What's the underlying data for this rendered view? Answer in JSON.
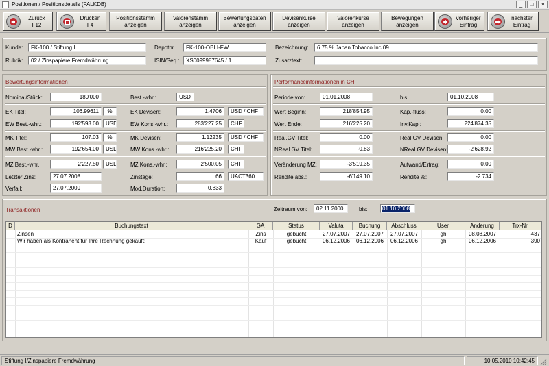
{
  "window": {
    "title": "Positionen / Positionsdetails  (FALKDB)"
  },
  "toolbar": {
    "back": "Zurück\nF12",
    "print": "Drucken\nF4",
    "positionsstamm": "Positionsstamm\nanzeigen",
    "valorenstamm": "Valorenstamm\nanzeigen",
    "bewertungsdaten": "Bewertungsdaten\nanzeigen",
    "devisenkurse": "Devisenkurse\nanzeigen",
    "valorenkurse": "Valorenkurse\nanzeigen",
    "bewegungen": "Bewegungen\nanzeigen",
    "prev": "vorheriger\nEintrag",
    "next": "nächster\nEintrag"
  },
  "header": {
    "kunde_label": "Kunde:",
    "kunde": "FK-100 / Stiftung I",
    "depotnr_label": "Depotnr.:",
    "depotnr": "FK-100-OBLI-FW",
    "bezeichnung_label": "Bezeichnung:",
    "bezeichnung": "6.75 %  Japan Tobacco Inc 09",
    "rubrik_label": "Rubrik:",
    "rubrik": "02 / Zinspapiere Fremdwährung",
    "isin_label": "ISIN/Seq.:",
    "isin": "XS0099987645 / 1",
    "zusatztext_label": "Zusatztext:",
    "zusatztext": ""
  },
  "bewertung": {
    "title": "Bewertungsinformationen",
    "nominal_label": "Nominal/Stück:",
    "nominal": "180'000",
    "bestwhr_label": "Best.-whr.:",
    "bestwhr": "USD",
    "ektitel_label": "EK Titel:",
    "ektitel": "106.99611",
    "ektitel_unit": "%",
    "ekdevisen_label": "EK Devisen:",
    "ekdevisen": "1.4706",
    "ekdevisen_unit": "USD / CHF",
    "ewbest_label": "EW Best.-whr.:",
    "ewbest": "192'593.00",
    "ewbest_unit": "USD",
    "ewkons_label": "EW Kons.-whr.:",
    "ewkons": "283'227.25",
    "ewkons_unit": "CHF",
    "mktitel_label": "MK Titel:",
    "mktitel": "107.03",
    "mktitel_unit": "%",
    "mkdevisen_label": "MK Devisen:",
    "mkdevisen": "1.12235",
    "mkdevisen_unit": "USD / CHF",
    "mwbest_label": "MW Best.-whr.:",
    "mwbest": "192'654.00",
    "mwbest_unit": "USD",
    "mwkons_label": "MW Kons.-whr.:",
    "mwkons": "216'225.20",
    "mwkons_unit": "CHF",
    "mzbest_label": "MZ Best.-whr.:",
    "mzbest": "2'227.50",
    "mzbest_unit": "USD",
    "mzkons_label": "MZ Kons.-whr.:",
    "mzkons": "2'500.05",
    "mzkons_unit": "CHF",
    "letzterzins_label": "Letzter Zins:",
    "letzterzins": "27.07.2008",
    "zinstage_label": "Zinstage:",
    "zinstage": "66",
    "zinstage_code": "UACT360",
    "verfall_label": "Verfall:",
    "verfall": "27.07.2009",
    "modduration_label": "Mod.Duration:",
    "modduration": "0.833"
  },
  "performance": {
    "title": "Performanceinformationen in CHF",
    "periode_label": "Periode von:",
    "periode_von": "01.01.2008",
    "bis_label": "bis:",
    "periode_bis": "01.10.2008",
    "wertbeginn_label": "Wert Beginn:",
    "wertbeginn": "218'854.95",
    "kapfluss_label": "Kap.-fluss:",
    "kapfluss": "0.00",
    "wertende_label": "Wert Ende:",
    "wertende": "216'225.20",
    "invkap_label": "Inv.Kap.:",
    "invkap": "224'874.35",
    "realgvtitel_label": "Real.GV Titel:",
    "realgvtitel": "0.00",
    "realgvdev_label": "Real.GV Devisen:",
    "realgvdev": "0.00",
    "nrealgvtitel_label": "NReal.GV Titel:",
    "nrealgvtitel": "-0.83",
    "nrealgvdev_label": "NReal.GV Devisen:",
    "nrealgvdev": "-2'628.92",
    "veraenderung_label": "Veränderung MZ:",
    "veraenderung": "-3'519.35",
    "aufwand_label": "Aufwand/Ertrag:",
    "aufwand": "0.00",
    "renditeabs_label": "Rendite abs.:",
    "renditeabs": "-6'149.10",
    "renditepct_label": "Rendite %:",
    "renditepct": "-2.734"
  },
  "transaktionen": {
    "title": "Transaktionen",
    "zeitraum_label": "Zeitraum von:",
    "zeitraum_von": "02.11.2000",
    "bis_label": "bis:",
    "zeitraum_bis": "01.10.2008",
    "columns": [
      "D",
      "Buchungstext",
      "GA",
      "Status",
      "Valuta",
      "Buchung",
      "Abschluss",
      "User",
      "Änderung",
      "Trx-Nr."
    ],
    "rows": [
      [
        "",
        "Zinsen",
        "Zins",
        "gebucht",
        "27.07.2007",
        "27.07.2007",
        "27.07.2007",
        "gh",
        "08.08.2007",
        "437"
      ],
      [
        "",
        "Wir haben als Kontrahent für Ihre Rechnung gekauft:",
        "Kauf",
        "gebucht",
        "06.12.2006",
        "06.12.2006",
        "06.12.2006",
        "gh",
        "06.12.2006",
        "390"
      ]
    ]
  },
  "statusbar": {
    "left": "Stiftung I/Zinspapiere Fremdwährung",
    "right": "10.05.2010 10:42:45"
  },
  "colors": {
    "section_title": "#8b1a1a",
    "selection": "#0a246a"
  },
  "icons": [
    "back-arrow-icon",
    "print-icon",
    "prev-arrow-icon",
    "next-arrow-icon",
    "resize-grip-icon"
  ]
}
